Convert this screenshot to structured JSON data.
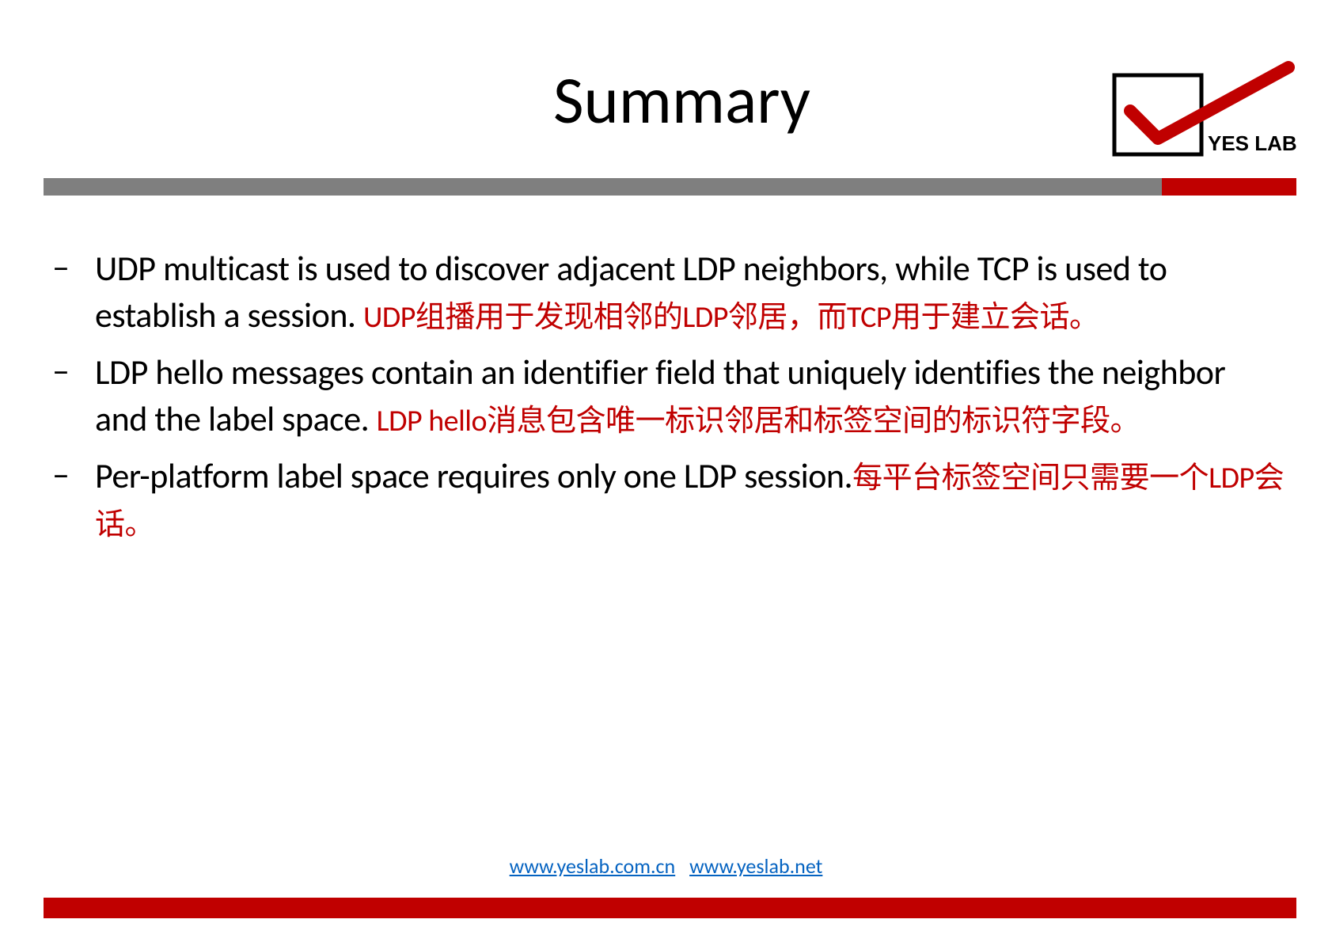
{
  "title": "Summary",
  "logo_text": "YES LAB",
  "bullets": [
    {
      "en": "UDP multicast is used to discover adjacent LDP neighbors, while  TCP is used to establish a session. ",
      "zh": "UDP组播用于发现相邻的LDP邻居，而TCP用于建立会话。"
    },
    {
      "en": "LDP hello messages contain an identifier field that uniquely identifies the neighbor and the label space. ",
      "zh": "LDP hello消息包含唯一标识邻居和标签空间的标识符字段。"
    },
    {
      "en": "Per-platform label space requires only one LDP session.",
      "zh": "每平台标签空间只需要一个LDP会话。"
    }
  ],
  "footer": {
    "link1": "www.yeslab.com.cn",
    "link2": "www.yeslab.net"
  }
}
